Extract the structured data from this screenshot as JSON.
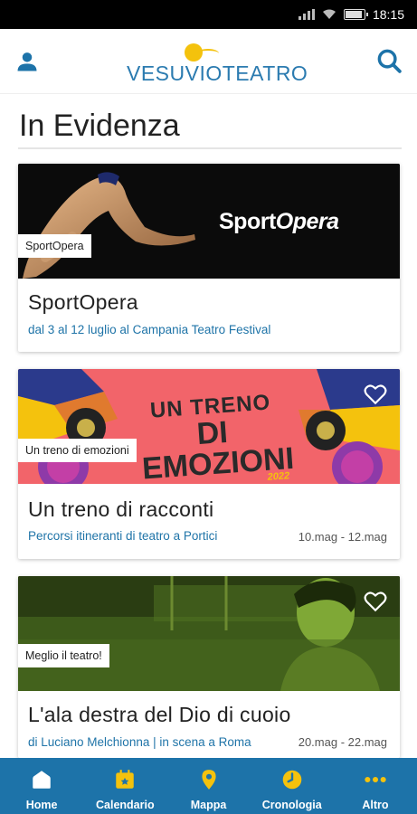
{
  "status_bar": {
    "time": "18:15"
  },
  "header": {
    "logo_text": "VESUVIOTEATRO",
    "user_icon": "user-icon",
    "search_icon": "search-icon"
  },
  "section": {
    "title": "In Evidenza"
  },
  "cards": [
    {
      "image_text": "SportOpera",
      "tag": "SportOpera",
      "title": "SportOpera",
      "subtitle": "dal 3 al 12 luglio al Campania Teatro Festival",
      "dates": ""
    },
    {
      "image_text_1": "UN TRENO",
      "image_text_2": "DI EMOZIONI",
      "image_year": "2022",
      "tag": "Un treno di emozioni",
      "title": "Un treno di racconti",
      "subtitle": "Percorsi itineranti di teatro a Portici",
      "dates": "10.mag - 12.mag"
    },
    {
      "tag": "Meglio il teatro!",
      "title": "L'ala destra del Dio di cuoio",
      "subtitle": "di Luciano Melchionna | in scena a Roma",
      "dates": "20.mag - 22.mag"
    }
  ],
  "bottom_nav": {
    "items": [
      {
        "label": "Home",
        "icon": "home-icon"
      },
      {
        "label": "Calendario",
        "icon": "calendar-icon"
      },
      {
        "label": "Mappa",
        "icon": "map-pin-icon"
      },
      {
        "label": "Cronologia",
        "icon": "clock-icon"
      },
      {
        "label": "Altro",
        "icon": "more-icon"
      }
    ]
  },
  "colors": {
    "accent": "#1d73a9",
    "link": "#1f74a8",
    "yellow": "#f4c20d",
    "coral": "#f2646a"
  }
}
